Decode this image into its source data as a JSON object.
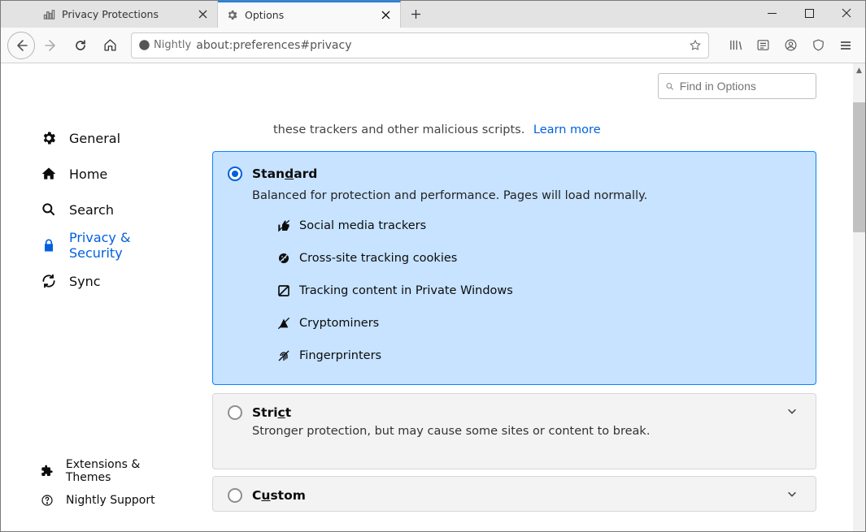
{
  "tabs": [
    {
      "title": "Privacy Protections"
    },
    {
      "title": "Options"
    }
  ],
  "url": {
    "channel": "Nightly",
    "address": "about:preferences#privacy"
  },
  "sidebar": {
    "items": [
      {
        "label": "General"
      },
      {
        "label": "Home"
      },
      {
        "label": "Search"
      },
      {
        "label": "Privacy & Security"
      },
      {
        "label": "Sync"
      }
    ],
    "footer": [
      {
        "label": "Extensions & Themes"
      },
      {
        "label": "Nightly Support"
      }
    ]
  },
  "search": {
    "placeholder": "Find in Options"
  },
  "intro": {
    "text": "these trackers and other malicious scripts.",
    "link": "Learn more"
  },
  "levels": {
    "standard": {
      "title_pre": "Stan",
      "title_u": "d",
      "title_post": "ard",
      "desc": "Balanced for protection and performance. Pages will load normally.",
      "items": [
        "Social media trackers",
        "Cross-site tracking cookies",
        "Tracking content in Private Windows",
        "Cryptominers",
        "Fingerprinters"
      ]
    },
    "strict": {
      "title_pre": "Stri",
      "title_u": "c",
      "title_post": "t",
      "desc": "Stronger protection, but may cause some sites or content to break."
    },
    "custom": {
      "title_pre": "C",
      "title_u": "u",
      "title_post": "stom"
    }
  }
}
